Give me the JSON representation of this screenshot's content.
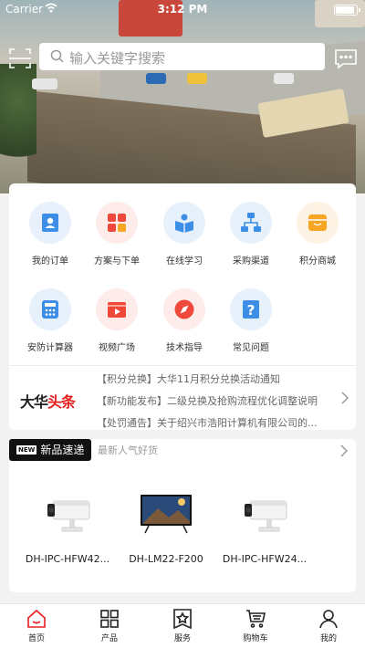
{
  "status_bar": {
    "carrier": "Carrier",
    "time": "3:12 PM"
  },
  "search": {
    "placeholder": "输入关键字搜索"
  },
  "banner": {
    "total_slides": 2,
    "active_slide": 1
  },
  "colors": {
    "accent": "#e51e1e",
    "active_dot": "#e51e1e",
    "inactive_dot": "#ffffff"
  },
  "quick_menu": [
    {
      "label": "我的订单",
      "icon": "order-icon",
      "bg": "#e8f1fb",
      "color": "#3d8ee6"
    },
    {
      "label": "方案与下单",
      "icon": "solution-icon",
      "bg": "#fdecea",
      "color": "#f0483a"
    },
    {
      "label": "在线学习",
      "icon": "study-icon",
      "bg": "#e6f1fb",
      "color": "#3d8ee6"
    },
    {
      "label": "采购渠道",
      "icon": "channel-icon",
      "bg": "#e6f1fb",
      "color": "#3d8ee6"
    },
    {
      "label": "积分商城",
      "icon": "points-mall-icon",
      "bg": "#fdf2e3",
      "color": "#f6a623"
    },
    {
      "label": "安防计算器",
      "icon": "calculator-icon",
      "bg": "#e6f1fb",
      "color": "#3d8ee6"
    },
    {
      "label": "视频广场",
      "icon": "video-icon",
      "bg": "#fdecea",
      "color": "#f0483a"
    },
    {
      "label": "技术指导",
      "icon": "compass-icon",
      "bg": "#fdecea",
      "color": "#f0483a"
    },
    {
      "label": "常见问题",
      "icon": "faq-icon",
      "bg": "#e6f1fb",
      "color": "#3d8ee6"
    }
  ],
  "news": {
    "logo_left": "大华",
    "logo_right": "头条",
    "items": [
      "【积分兑换】大华11月积分兑换活动通知",
      "【新功能发布】二级兑换及抢购流程优化调整说明",
      "【处罚通告】关于绍兴市浩阳计算机有限公司的..."
    ]
  },
  "new_products": {
    "badge_tag": "NEW",
    "title": "新品速递",
    "subtitle": "最新人气好货",
    "items": [
      {
        "name": "DH-IPC-HFW42...",
        "icon": "bullet-camera-icon"
      },
      {
        "name": "DH-LM22-F200",
        "icon": "monitor-icon"
      },
      {
        "name": "DH-IPC-HFW24...",
        "icon": "bullet-camera-icon"
      }
    ]
  },
  "tabs": [
    {
      "label": "首页",
      "icon": "home-icon",
      "active": true
    },
    {
      "label": "产品",
      "icon": "products-icon",
      "active": false
    },
    {
      "label": "服务",
      "icon": "service-icon",
      "active": false
    },
    {
      "label": "购物车",
      "icon": "cart-icon",
      "active": false
    },
    {
      "label": "我的",
      "icon": "profile-icon",
      "active": false
    }
  ]
}
